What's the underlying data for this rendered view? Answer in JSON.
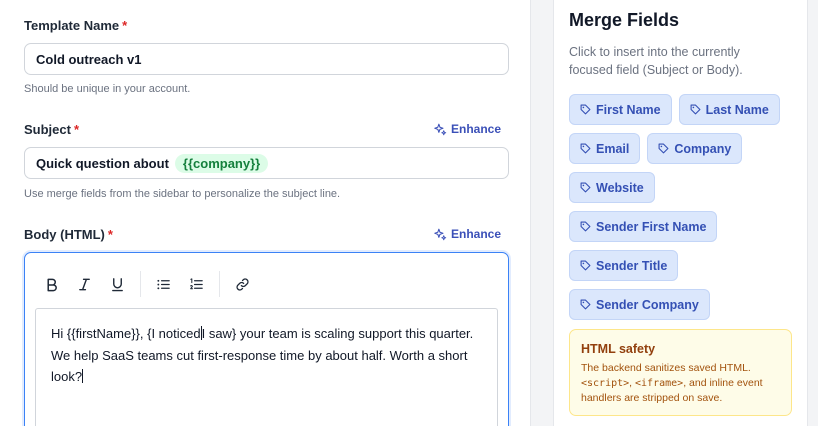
{
  "template_name": {
    "label": "Template Name",
    "required_mark": "*",
    "value": "Cold outreach v1",
    "help": "Should be unique in your account."
  },
  "subject": {
    "label": "Subject",
    "required_mark": "*",
    "enhance_label": "Enhance",
    "value_text": "Quick question about",
    "value_token": "{{company}}",
    "help": "Use merge fields from the sidebar to personalize the subject line."
  },
  "body": {
    "label": "Body (HTML)",
    "required_mark": "*",
    "enhance_label": "Enhance",
    "content_before_caret": "Hi {{firstName}}, {I noticed",
    "content_after_caret": "I saw} your team is scaling support this quarter. We help SaaS teams cut first-response time by about half. Worth a short look?",
    "toolbar": [
      "bold-icon",
      "italic-icon",
      "underline-icon",
      "bullet-list-icon",
      "numbered-list-icon",
      "link-icon"
    ]
  },
  "sidebar": {
    "title": "Merge Fields",
    "description": "Click to insert into the currently focused field (Subject or Body).",
    "fields": [
      [
        "First Name",
        "Last Name"
      ],
      [
        "Email",
        "Company"
      ],
      [
        "Website"
      ],
      [
        "Sender First Name"
      ],
      [
        "Sender Title"
      ],
      [
        "Sender Company"
      ]
    ],
    "safety": {
      "title": "HTML safety",
      "text_1": "The backend sanitizes saved HTML.",
      "code_1": "<script>",
      "sep_1": ", ",
      "code_2": "<iframe>",
      "text_2": ", and inline event handlers are stripped on save."
    }
  },
  "colors": {
    "accent": "#3b50b8",
    "required": "#dc2626",
    "chip_bg": "#dbe7fc",
    "token_bg": "#dcfce7",
    "warning_bg": "#fefce8"
  }
}
